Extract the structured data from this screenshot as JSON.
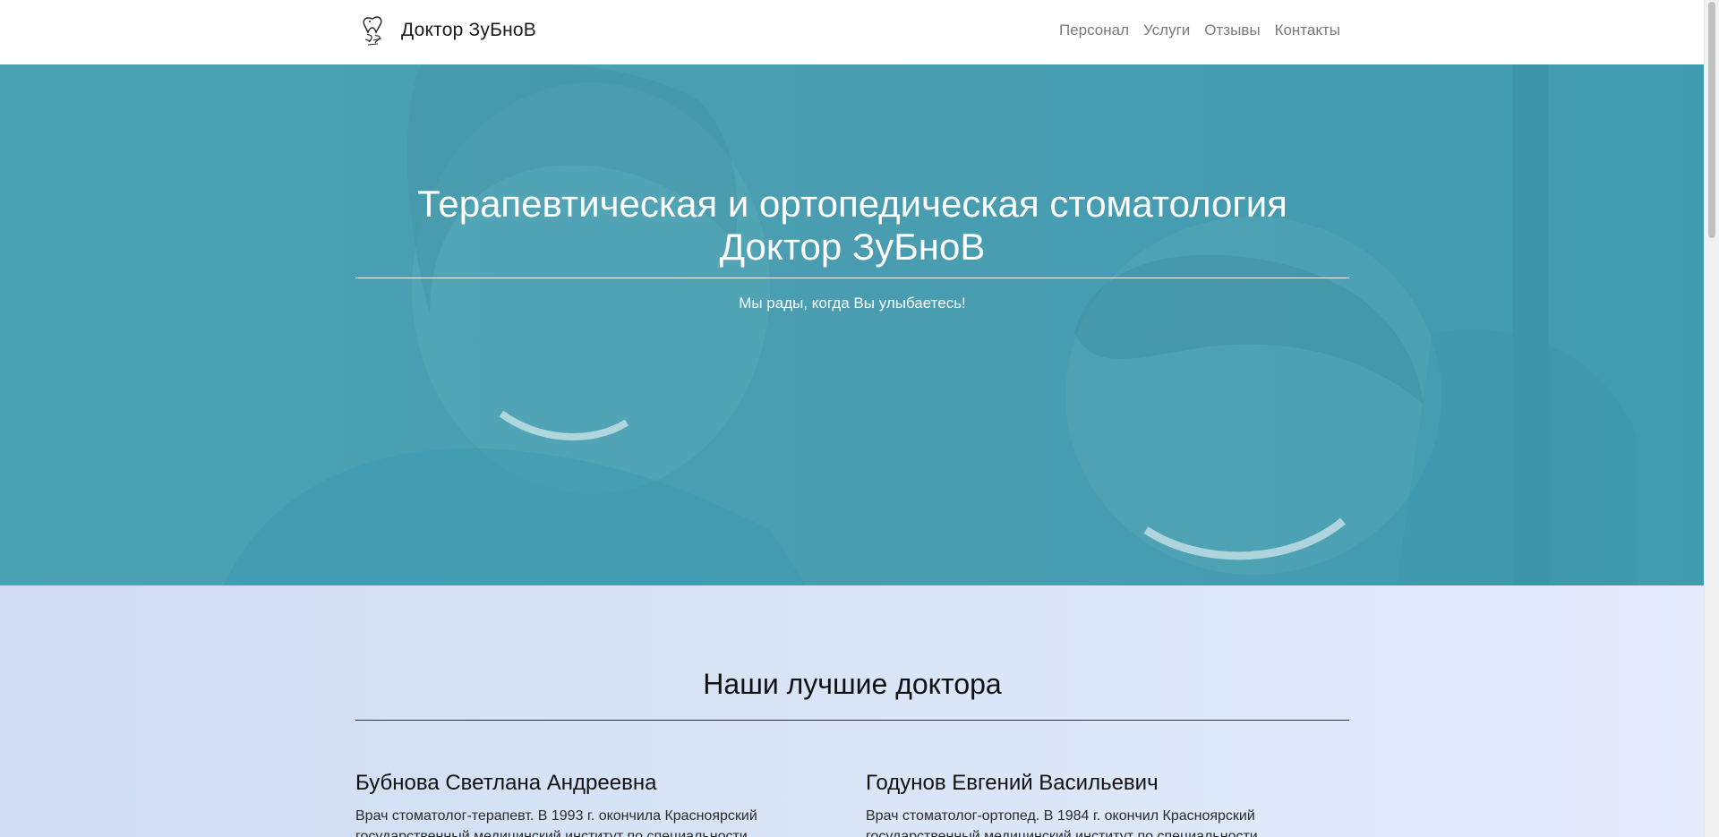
{
  "header": {
    "brand_name": "Доктор ЗуБноВ",
    "logo_icon": "tooth-logo-icon",
    "nav": [
      {
        "label": "Персонал"
      },
      {
        "label": "Услуги"
      },
      {
        "label": "Отзывы"
      },
      {
        "label": "Контакты"
      }
    ]
  },
  "hero": {
    "title": "Терапевтическая и ортопедическая стоматология Доктор ЗуБноВ",
    "subtitle": "Мы рады, когда Вы улыбаетесь!",
    "overlay_color": "#45a3b5"
  },
  "doctors_section": {
    "title": "Наши лучшие доктора",
    "doctors": [
      {
        "name": "Бубнова Светлана Андреевна",
        "description": "Врач стоматолог-терапевт. В 1993 г. окончила Красноярский государственный медицинский институт по специальности"
      },
      {
        "name": "Годунов Евгений Васильевич",
        "description": "Врач стоматолог-ортопед. В 1984 г. окончил Красноярский государственный медицинский институт по специальности"
      }
    ]
  },
  "colors": {
    "nav_text": "#7a7a7a",
    "section_bg_start": "#cfdcf2",
    "section_bg_end": "#e3ebfb"
  }
}
